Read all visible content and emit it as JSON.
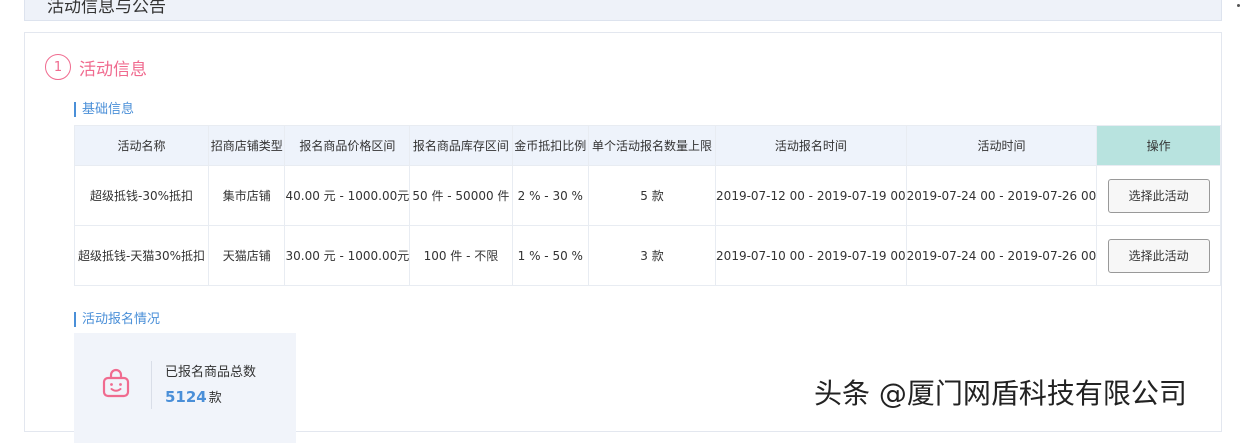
{
  "header": {
    "title": "活动信息与公告"
  },
  "step": {
    "number": "1",
    "title": "活动信息"
  },
  "basic_info": {
    "title": "基础信息",
    "columns": [
      "活动名称",
      "招商店铺类型",
      "报名商品价格区间",
      "报名商品库存区间",
      "金币抵扣比例",
      "单个活动报名数量上限",
      "活动报名时间",
      "活动时间",
      "操作"
    ],
    "rows": [
      {
        "name": "超级抵钱-30%抵扣",
        "store_type": "集市店铺",
        "price_range": "40.00 元 - 1000.00元",
        "stock_range": "50 件 - 50000 件",
        "ratio": "2 % - 30 %",
        "limit": "5 款",
        "signup_time": "2019-07-12 00 - 2019-07-19 00",
        "activity_time": "2019-07-24 00 - 2019-07-26 00",
        "action": "选择此活动"
      },
      {
        "name": "超级抵钱-天猫30%抵扣",
        "store_type": "天猫店铺",
        "price_range": "30.00 元 - 1000.00元",
        "stock_range": "100 件 - 不限",
        "ratio": "1 % - 50 %",
        "limit": "3 款",
        "signup_time": "2019-07-10 00 - 2019-07-19 00",
        "activity_time": "2019-07-24 00 - 2019-07-26 00",
        "action": "选择此活动"
      }
    ]
  },
  "signup_status": {
    "title": "活动报名情况",
    "stat_label": "已报名商品总数",
    "stat_value": "5124",
    "stat_unit": "款",
    "icon": "shopping-bag-icon"
  },
  "watermark": "头条 @厦门网盾科技有限公司",
  "colors": {
    "accent_pink": "#f06b8f",
    "accent_blue": "#4a8fd8",
    "action_header": "#b8e3df"
  }
}
